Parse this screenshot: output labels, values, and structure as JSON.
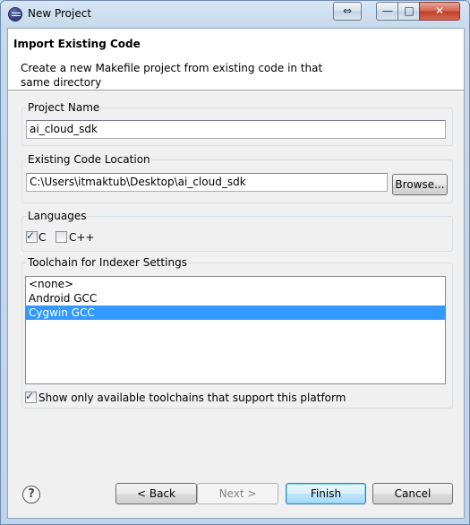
{
  "window": {
    "title": "New Project",
    "controls": {
      "swap": "⇔",
      "minimize": "—",
      "maximize": "□",
      "close": "✕"
    }
  },
  "header": {
    "title": "Import Existing Code",
    "description": "Create a new Makefile project from existing code in that same directory"
  },
  "project_name": {
    "label": "Project Name",
    "value": "ai_cloud_sdk"
  },
  "code_location": {
    "label": "Existing Code Location",
    "value": "C:\\Users\\itmaktub\\Desktop\\ai_cloud_sdk",
    "browse_label": "Browse..."
  },
  "languages": {
    "label": "Languages",
    "items": [
      {
        "label": "C",
        "checked": true
      },
      {
        "label": "C++",
        "checked": false
      }
    ]
  },
  "toolchain": {
    "label": "Toolchain for Indexer Settings",
    "options": [
      "<none>",
      "Android GCC",
      "Cygwin GCC"
    ],
    "selected": "Cygwin GCC",
    "filter_label": "Show only available toolchains that support this platform",
    "filter_checked": true
  },
  "footer": {
    "help_icon": "?",
    "back_label": "< Back",
    "next_label": "Next >",
    "finish_label": "Finish",
    "cancel_label": "Cancel"
  }
}
